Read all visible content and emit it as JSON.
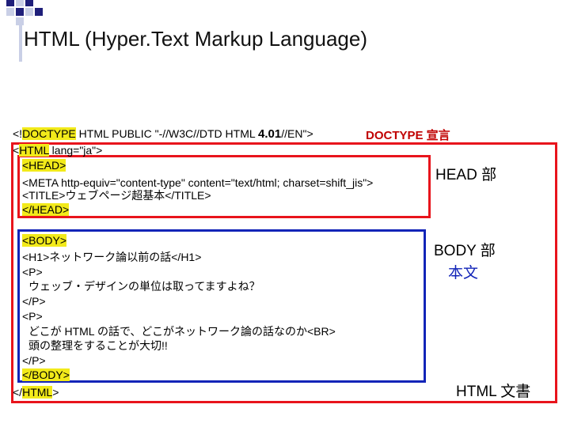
{
  "slide": {
    "title": "HTML (Hyper.Text Markup Language)"
  },
  "code": {
    "doctype": {
      "open": "<!",
      "keyword": "DOCTYPE",
      "mid": " HTML PUBLIC \"-//W3C//DTD HTML ",
      "version": "4.01",
      "end": "//EN\">"
    },
    "html_open": {
      "open": "<",
      "tag": "HTML",
      "rest": " lang=\"ja\">"
    },
    "head_open": "<HEAD>",
    "meta": "<META http-equiv=\"content-type\" content=\"text/html; charset=shift_jis\">",
    "title_tag": "<TITLE>ウェブページ超基本</TITLE>",
    "head_close": "</HEAD>",
    "body_open": "<BODY>",
    "h1": "<H1>ネットワーク論以前の話</H1>",
    "p_open_1": "<P>",
    "p_text_1": "ウェッブ・デザインの単位は取ってますよね？",
    "p_close_1": "</P>",
    "p_open_2": "<P>",
    "p_text_2": "どこが HTML の話で、どこがネットワーク論の話なのか<BR>",
    "p_text_3": "頭の整理をすることが大切!!",
    "p_close_2": "</P>",
    "body_close": "</BODY>",
    "html_close": {
      "open": "</",
      "tag": "HTML",
      "rest": ">"
    }
  },
  "annotations": {
    "doctype": "DOCTYPE 宣言",
    "head": "HEAD 部",
    "body": "BODY 部",
    "body_text": "本文",
    "html_doc": "HTML 文書"
  },
  "colors": {
    "highlight": "#f2ea1a",
    "red_box": "#e8141c",
    "blue_box": "#1224b8",
    "doctype_note": "#c00000"
  }
}
